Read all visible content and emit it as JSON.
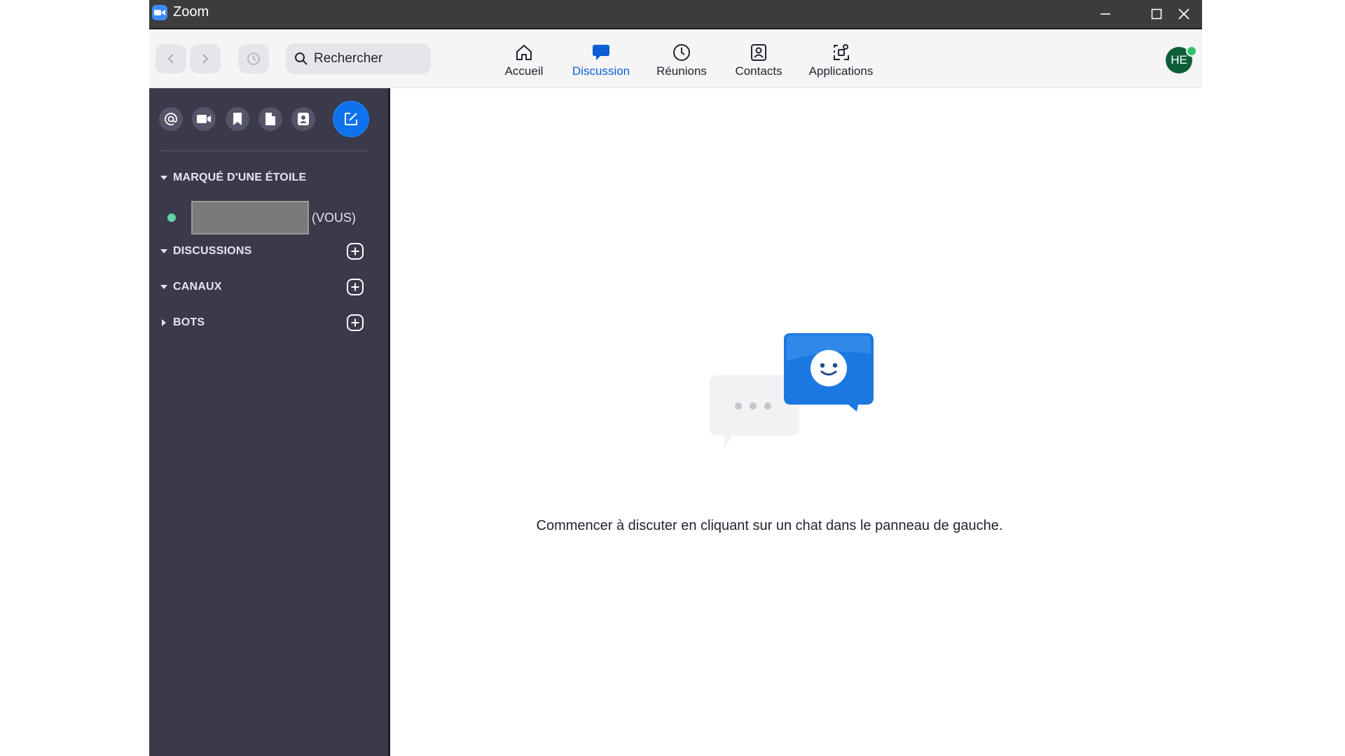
{
  "window": {
    "app_title": "Zoom",
    "icons": {
      "logo": "zoom-logo-icon",
      "minimize": "minimize-icon",
      "maximize": "maximize-icon",
      "close": "close-icon"
    }
  },
  "topnav": {
    "search": {
      "placeholder": "Rechercher",
      "value": ""
    },
    "tabs": [
      {
        "label": "Accueil",
        "icon": "home-icon",
        "active": false
      },
      {
        "label": "Discussion",
        "icon": "chat-bubble-icon",
        "active": true
      },
      {
        "label": "Réunions",
        "icon": "clock-icon",
        "active": false
      },
      {
        "label": "Contacts",
        "icon": "contact-card-icon",
        "active": false
      },
      {
        "label": "Applications",
        "icon": "apps-icon",
        "active": false
      }
    ],
    "avatar_initials": "HE",
    "accent_color": "#0e5ed4",
    "presence_color": "#2ec26b"
  },
  "sidebar": {
    "tools": [
      "mention-icon",
      "video-icon",
      "bookmark-icon",
      "file-icon",
      "contact-icon",
      "compose-icon"
    ],
    "sections": {
      "starred": "MARQUÉ D'UNE ÉTOILE",
      "chats": "DISCUSSIONS",
      "channels": "CANAUX",
      "bots": "BOTS"
    },
    "starred_contact": {
      "suffix": "(VOUS)"
    }
  },
  "main": {
    "empty_state_text": "Commencer à discuter en cliquant sur un chat dans le panneau de gauche."
  }
}
